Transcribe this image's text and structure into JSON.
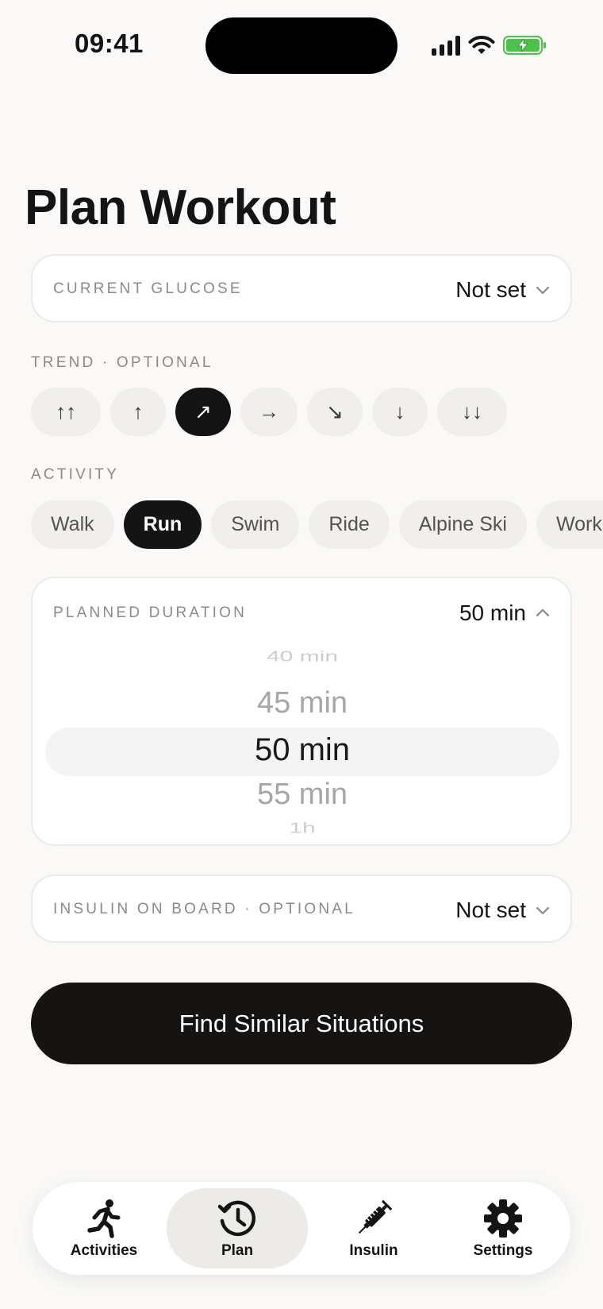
{
  "status_bar": {
    "time": "09:41"
  },
  "title": "Plan Workout",
  "glucose": {
    "label": "CURRENT GLUCOSE",
    "value": "Not set"
  },
  "trend": {
    "label": "TREND · OPTIONAL",
    "options": [
      {
        "glyph": "↑↑",
        "name": "rising-fast"
      },
      {
        "glyph": "↑",
        "name": "rising"
      },
      {
        "glyph": "↗",
        "name": "rising-slowly",
        "selected": true
      },
      {
        "glyph": "→",
        "name": "steady"
      },
      {
        "glyph": "↘",
        "name": "falling-slowly"
      },
      {
        "glyph": "↓",
        "name": "falling"
      },
      {
        "glyph": "↓↓",
        "name": "falling-fast"
      }
    ]
  },
  "activity": {
    "label": "ACTIVITY",
    "options": [
      {
        "label": "Walk"
      },
      {
        "label": "Run",
        "selected": true
      },
      {
        "label": "Swim"
      },
      {
        "label": "Ride"
      },
      {
        "label": "Alpine Ski"
      },
      {
        "label": "Workout"
      }
    ]
  },
  "duration": {
    "label": "PLANNED DURATION",
    "value": "50 min",
    "picker": [
      "40 min",
      "45 min",
      "50 min",
      "55 min",
      "1h"
    ],
    "selected_index": 2
  },
  "insulin": {
    "label": "INSULIN ON BOARD · OPTIONAL",
    "value": "Not set"
  },
  "primary_button": "Find Similar Situations",
  "tabs": [
    {
      "label": "Activities",
      "icon": "runner-icon"
    },
    {
      "label": "Plan",
      "icon": "clock-history-icon",
      "active": true
    },
    {
      "label": "Insulin",
      "icon": "syringe-icon"
    },
    {
      "label": "Settings",
      "icon": "gear-icon"
    }
  ]
}
